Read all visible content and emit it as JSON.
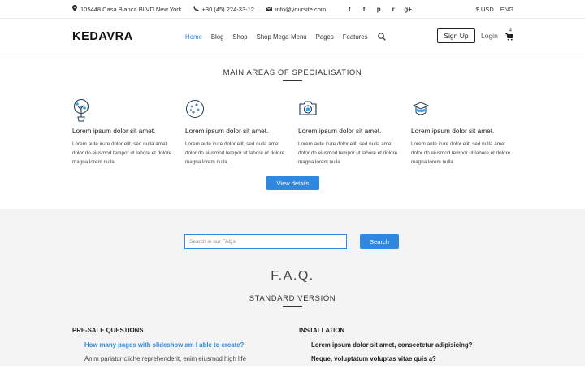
{
  "topbar": {
    "address": "105448 Casa Blanca BLVD New York",
    "phone": "+30 (45) 224-33-12",
    "email": "info@yoursite.com",
    "social": [
      "f",
      "t",
      "p",
      "r",
      "g+"
    ],
    "currency": "$ USD",
    "language": "ENG"
  },
  "nav": {
    "logo": "KEDAVRA",
    "items": [
      "Home",
      "Blog",
      "Shop",
      "Shop Mega-Menu",
      "Pages",
      "Features"
    ],
    "signup": "Sign Up",
    "login": "Login",
    "cart_count": "4"
  },
  "specialisation": {
    "title": "MAIN AREAS OF SPECIALISATION",
    "features": [
      {
        "icon": "plant-icon",
        "title": "Lorem ipsum dolor sit amet.",
        "text": "Lorem aute irure dolor elit, sed nulla amet dolor do eiusmod tempor ut labore et dolore magna lorem nulla."
      },
      {
        "icon": "cookie-icon",
        "title": "Lorem ipsum dolor sit amet.",
        "text": "Lorem aute irure dolor elit, sed nulla amet dolor do eiusmod tempor ut labore et dolore magna lorem nulla."
      },
      {
        "icon": "camera-icon",
        "title": "Lorem ipsum dolor sit amet.",
        "text": "Lorem aute irure dolor elit, sed nulla amet dolor do eiusmod tempor ut labore et dolore magna lorem nulla."
      },
      {
        "icon": "hat-icon",
        "title": "Lorem ipsum dolor sit amet.",
        "text": "Lorem aute irure dolor elit, sed nulla amet dolor do eiusmod tempor ut labore et dolore magna lorem nulla."
      }
    ],
    "button": "View details"
  },
  "faq": {
    "search_placeholder": "Search in our FAQs",
    "search_button": "Search",
    "title": "F.A.Q.",
    "subtitle": "STANDARD VERSION",
    "columns": [
      {
        "heading": "PRE-SALE QUESTIONS",
        "q1": "How many pages with slideshow am I able to create?",
        "a1": "Anim pariatur cliche reprehenderit, enim eiusmod high life"
      },
      {
        "heading": "INSTALLATION",
        "q1": "Lorem ipsum dolor sit amet, consectetur adipisicing?",
        "q2": "Neque, voluptatum voluptas vitae quis a?"
      }
    ]
  },
  "colors": {
    "accent": "#2f87e0",
    "section_bg": "#f4f4f4"
  }
}
